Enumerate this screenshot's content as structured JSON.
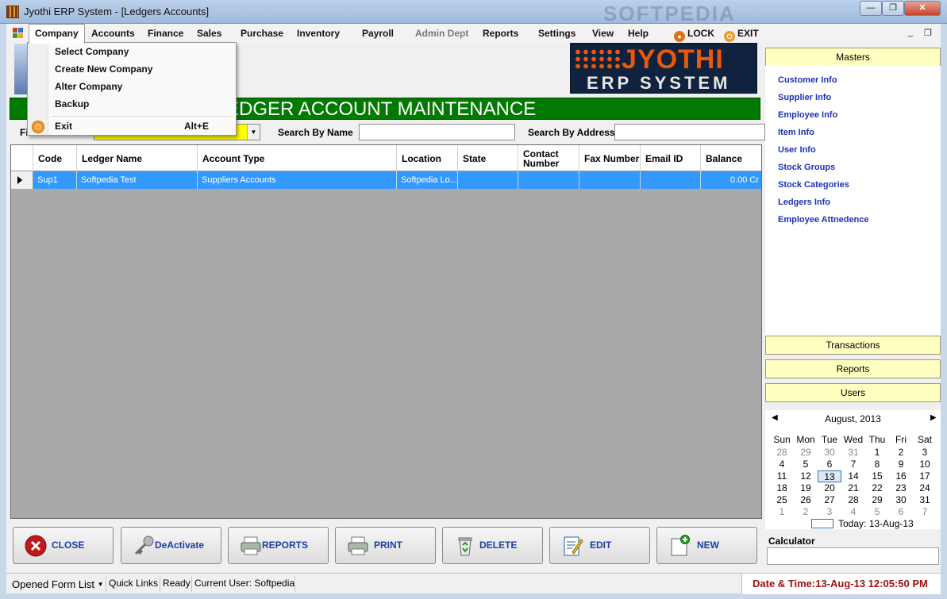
{
  "window": {
    "title": "Jyothi ERP System - [Ledgers Accounts]",
    "watermark": "SOFTPEDIA",
    "min_glyph": "—",
    "max_glyph": "❐",
    "close_glyph": "✕"
  },
  "menubar": {
    "items": [
      "Company",
      "Accounts",
      "Finance",
      "Sales",
      "Purchase",
      "Inventory",
      "Payroll",
      "Admin Dept",
      "Reports",
      "Settings",
      "View",
      "Help"
    ],
    "lock": "LOCK",
    "exit": "EXIT",
    "mdi_min": "_",
    "mdi_restore": "❐"
  },
  "company_menu": {
    "items": [
      "Select Company",
      "Create New Company",
      "Alter Company",
      "Backup"
    ],
    "exit_label": "Exit",
    "exit_shortcut": "Alt+E"
  },
  "logo": {
    "line1": "JYOTHI",
    "line2": "ERP SYSTEM"
  },
  "heading": "EDGER ACCOUNT MAINTENANCE",
  "search": {
    "first_label": "Fi",
    "by_name_label": "Search By Name",
    "by_address_label": "Search By Address",
    "name_value": "",
    "address_value": ""
  },
  "grid": {
    "columns": [
      "Code",
      "Ledger Name",
      "Account Type",
      "Location",
      "State",
      "Contact Number",
      "Fax Number",
      "Email ID",
      "Balance"
    ],
    "rows": [
      [
        "Sup1",
        "Softpedia Test",
        "Suppliers Accounts",
        "Softpedia Lo...",
        "",
        "",
        "",
        "",
        "0.00 Cr"
      ]
    ]
  },
  "buttons": {
    "close": "CLOSE",
    "deactivate": "DeActivate",
    "reports": "REPORTS",
    "print": "PRINT",
    "delete": "DELETE",
    "edit": "EDIT",
    "new": "NEW"
  },
  "statusbar": {
    "opened_forms": "Opened Form List",
    "quick_links": "Quick Links",
    "status": "Ready",
    "current_user": "Current User: Softpedia",
    "datetime": "Date & Time:13-Aug-13 12:05:50 PM"
  },
  "panel": {
    "masters": "Masters",
    "links": [
      "Customer Info",
      "Supplier Info",
      "Employee Info",
      "Item Info",
      "User Info",
      "Stock Groups",
      "Stock Categories",
      "Ledgers Info",
      "Employee Attnedence"
    ],
    "transactions": "Transactions",
    "reports": "Reports",
    "users": "Users"
  },
  "calendar": {
    "month": "August, 2013",
    "dow": [
      "Sun",
      "Mon",
      "Tue",
      "Wed",
      "Thu",
      "Fri",
      "Sat"
    ],
    "weeks": [
      [
        "28",
        "29",
        "30",
        "31",
        "1",
        "2",
        "3"
      ],
      [
        "4",
        "5",
        "6",
        "7",
        "8",
        "9",
        "10"
      ],
      [
        "11",
        "12",
        "13",
        "14",
        "15",
        "16",
        "17"
      ],
      [
        "18",
        "19",
        "20",
        "21",
        "22",
        "23",
        "24"
      ],
      [
        "25",
        "26",
        "27",
        "28",
        "29",
        "30",
        "31"
      ],
      [
        "1",
        "2",
        "3",
        "4",
        "5",
        "6",
        "7"
      ]
    ],
    "today_label": "Today: 13-Aug-13"
  },
  "calculator_label": "Calculator",
  "colors": {
    "heading_bg": "#007a00",
    "selected_row": "#3399ff",
    "nav_header": "#ffffc0",
    "link": "#1c32b8",
    "datetime": "#9a1010"
  }
}
